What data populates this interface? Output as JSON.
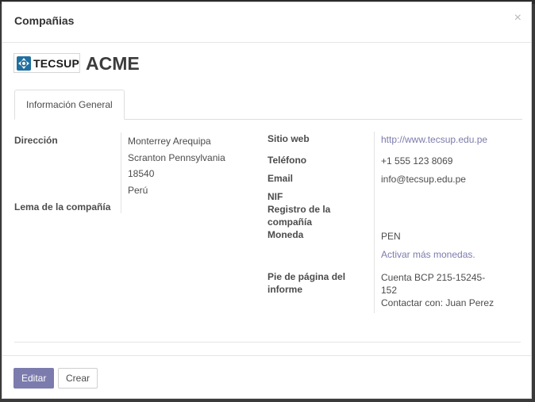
{
  "dialog": {
    "title": "Compañias",
    "close_symbol": "×"
  },
  "company": {
    "logo_text": "TECSUP",
    "name": "ACME"
  },
  "tabs": [
    {
      "label": "Información General"
    }
  ],
  "left_fields": {
    "address_label": "Dirección",
    "address_lines": [
      "Monterrey Arequipa",
      "Scranton Pennsylvania",
      "18540",
      "Perú"
    ],
    "motto_label": "Lema de la compañía"
  },
  "right_fields": {
    "website_label": "Sitio web",
    "website_value": "http://www.tecsup.edu.pe",
    "phone_label": "Teléfono",
    "phone_value": "+1 555 123 8069",
    "email_label": "Email",
    "email_value": "info@tecsup.edu.pe",
    "nif_label": "NIF",
    "registry_label_lines": [
      "Registro de la",
      "compañía"
    ],
    "currency_label": "Moneda",
    "currency_value": "PEN",
    "currency_link": "Activar más monedas.",
    "footer_label_lines": [
      "Pie de página del",
      "informe"
    ],
    "footer_value_lines": [
      "Cuenta BCP 215-15245-",
      "152",
      "Contactar con: Juan Perez"
    ]
  },
  "buttons": {
    "edit": "Editar",
    "create": "Crear"
  },
  "colors": {
    "primary": "#7c7bad",
    "link": "#7c7bad"
  },
  "icons": {
    "close": "close-icon",
    "logo": "tecsup-logo-icon"
  }
}
